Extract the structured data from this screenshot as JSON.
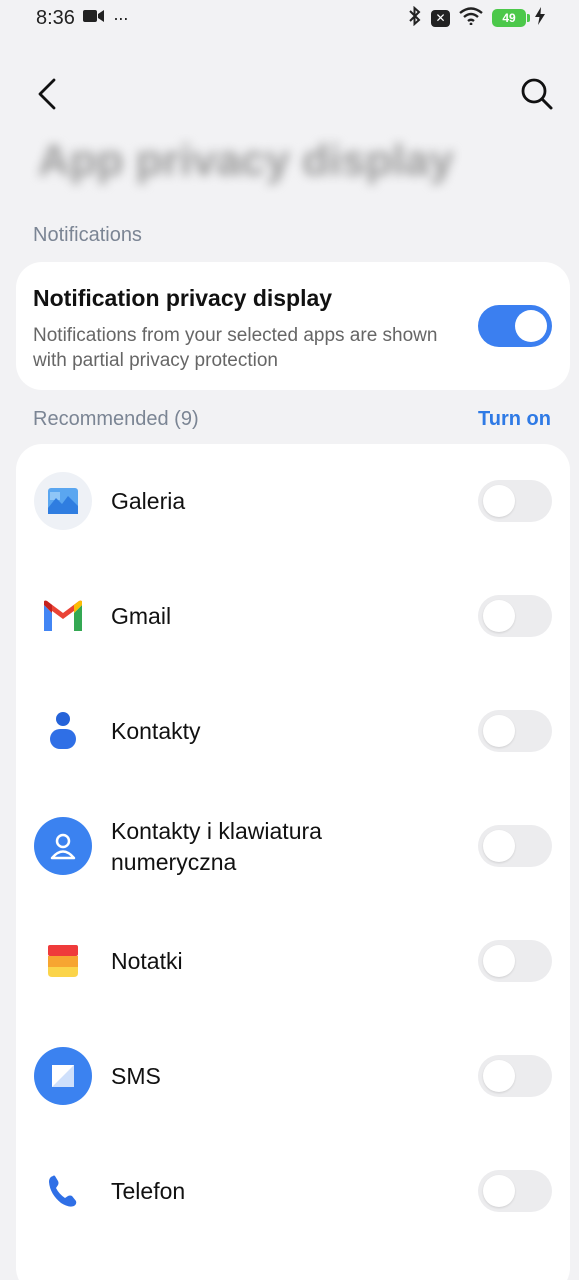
{
  "status_bar": {
    "time": "8:36",
    "dots": "···",
    "battery": "49",
    "icons": [
      "video-icon",
      "bluetooth-icon",
      "x-box-icon",
      "wifi-icon",
      "charging-icon"
    ]
  },
  "header": {
    "title": "App privacy display"
  },
  "notifications_section": {
    "label": "Notifications",
    "privacy": {
      "title": "Notification privacy display",
      "description": "Notifications from your selected apps are shown with partial privacy protection",
      "enabled": true
    }
  },
  "recommended": {
    "label": "Recommended (9)",
    "action": "Turn on",
    "apps": [
      {
        "name": "Galeria",
        "icon": "gallery-icon",
        "enabled": false
      },
      {
        "name": "Gmail",
        "icon": "gmail-icon",
        "enabled": false
      },
      {
        "name": "Kontakty",
        "icon": "contacts-icon",
        "enabled": false
      },
      {
        "name": "Kontakty i klawiatura numeryczna",
        "icon": "contacts-dialer-icon",
        "enabled": false
      },
      {
        "name": "Notatki",
        "icon": "notes-icon",
        "enabled": false
      },
      {
        "name": "SMS",
        "icon": "sms-icon",
        "enabled": false
      },
      {
        "name": "Telefon",
        "icon": "phone-icon",
        "enabled": false
      }
    ]
  },
  "colors": {
    "accent": "#3b7ff0",
    "link": "#2f7ae5",
    "background": "#f2f2f4",
    "section_label": "#7b8594"
  }
}
